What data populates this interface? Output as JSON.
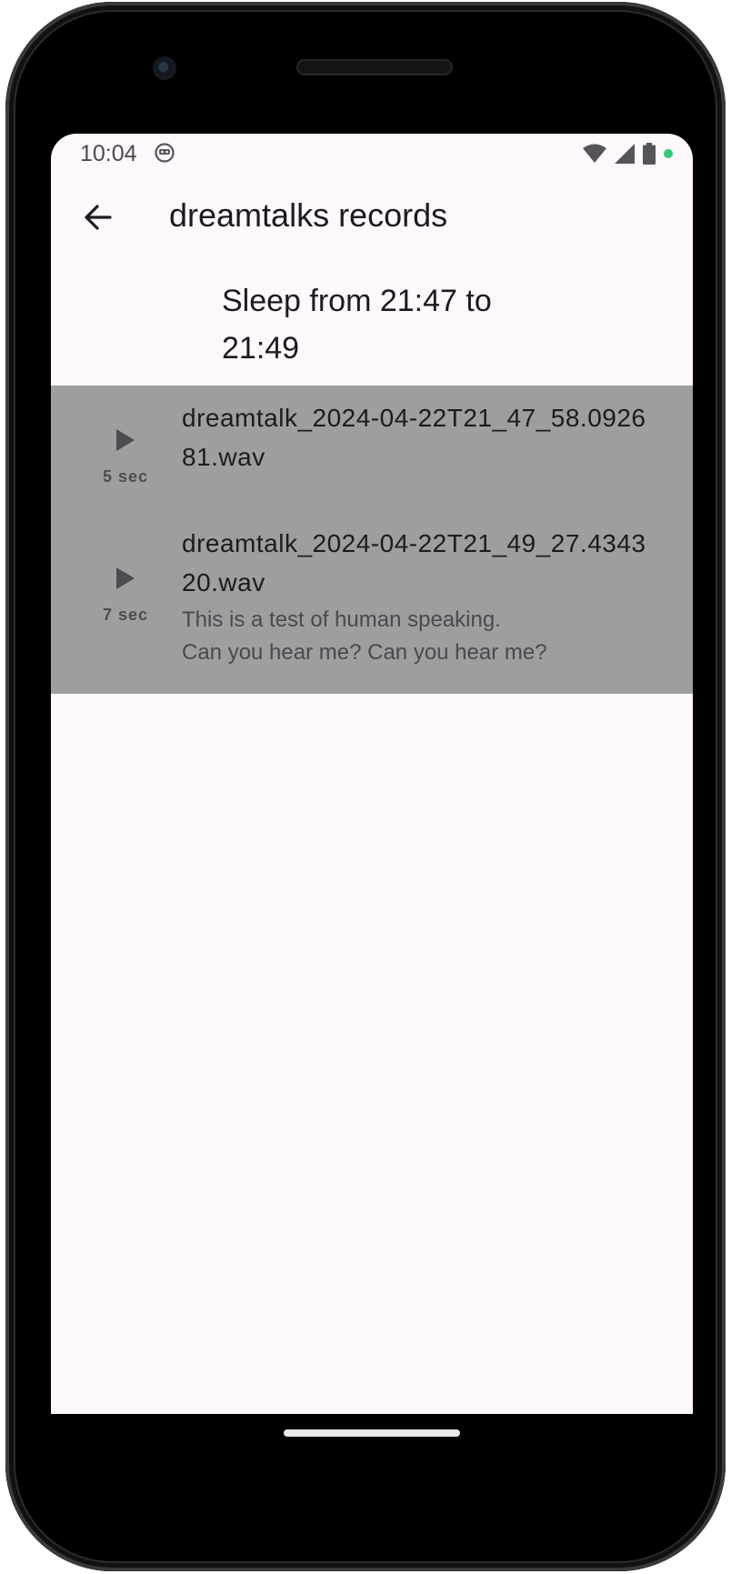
{
  "status_bar": {
    "time": "10:04",
    "icons": [
      "robot-face-icon",
      "wifi-icon",
      "signal-icon",
      "battery-icon",
      "mic-active-dot-icon"
    ]
  },
  "app_bar": {
    "back_icon": "arrow-back-icon",
    "title": "dreamtalks records"
  },
  "section": {
    "title": "Sleep from 21:47 to 21:49"
  },
  "records": [
    {
      "filename": "dreamtalk_2024-04-22T21_47_58.092681.wav",
      "duration": "5 sec",
      "transcript": ""
    },
    {
      "filename": "dreamtalk_2024-04-22T21_49_27.434320.wav",
      "duration": "7 sec",
      "transcript": "This is a test of human speaking.\n Can you hear me? Can you hear me?"
    }
  ],
  "colors": {
    "screen_bg": "#fef7fb",
    "list_bg": "#9e9e9e",
    "text_primary": "#1d1b20",
    "status_dot": "#2ecc71"
  }
}
